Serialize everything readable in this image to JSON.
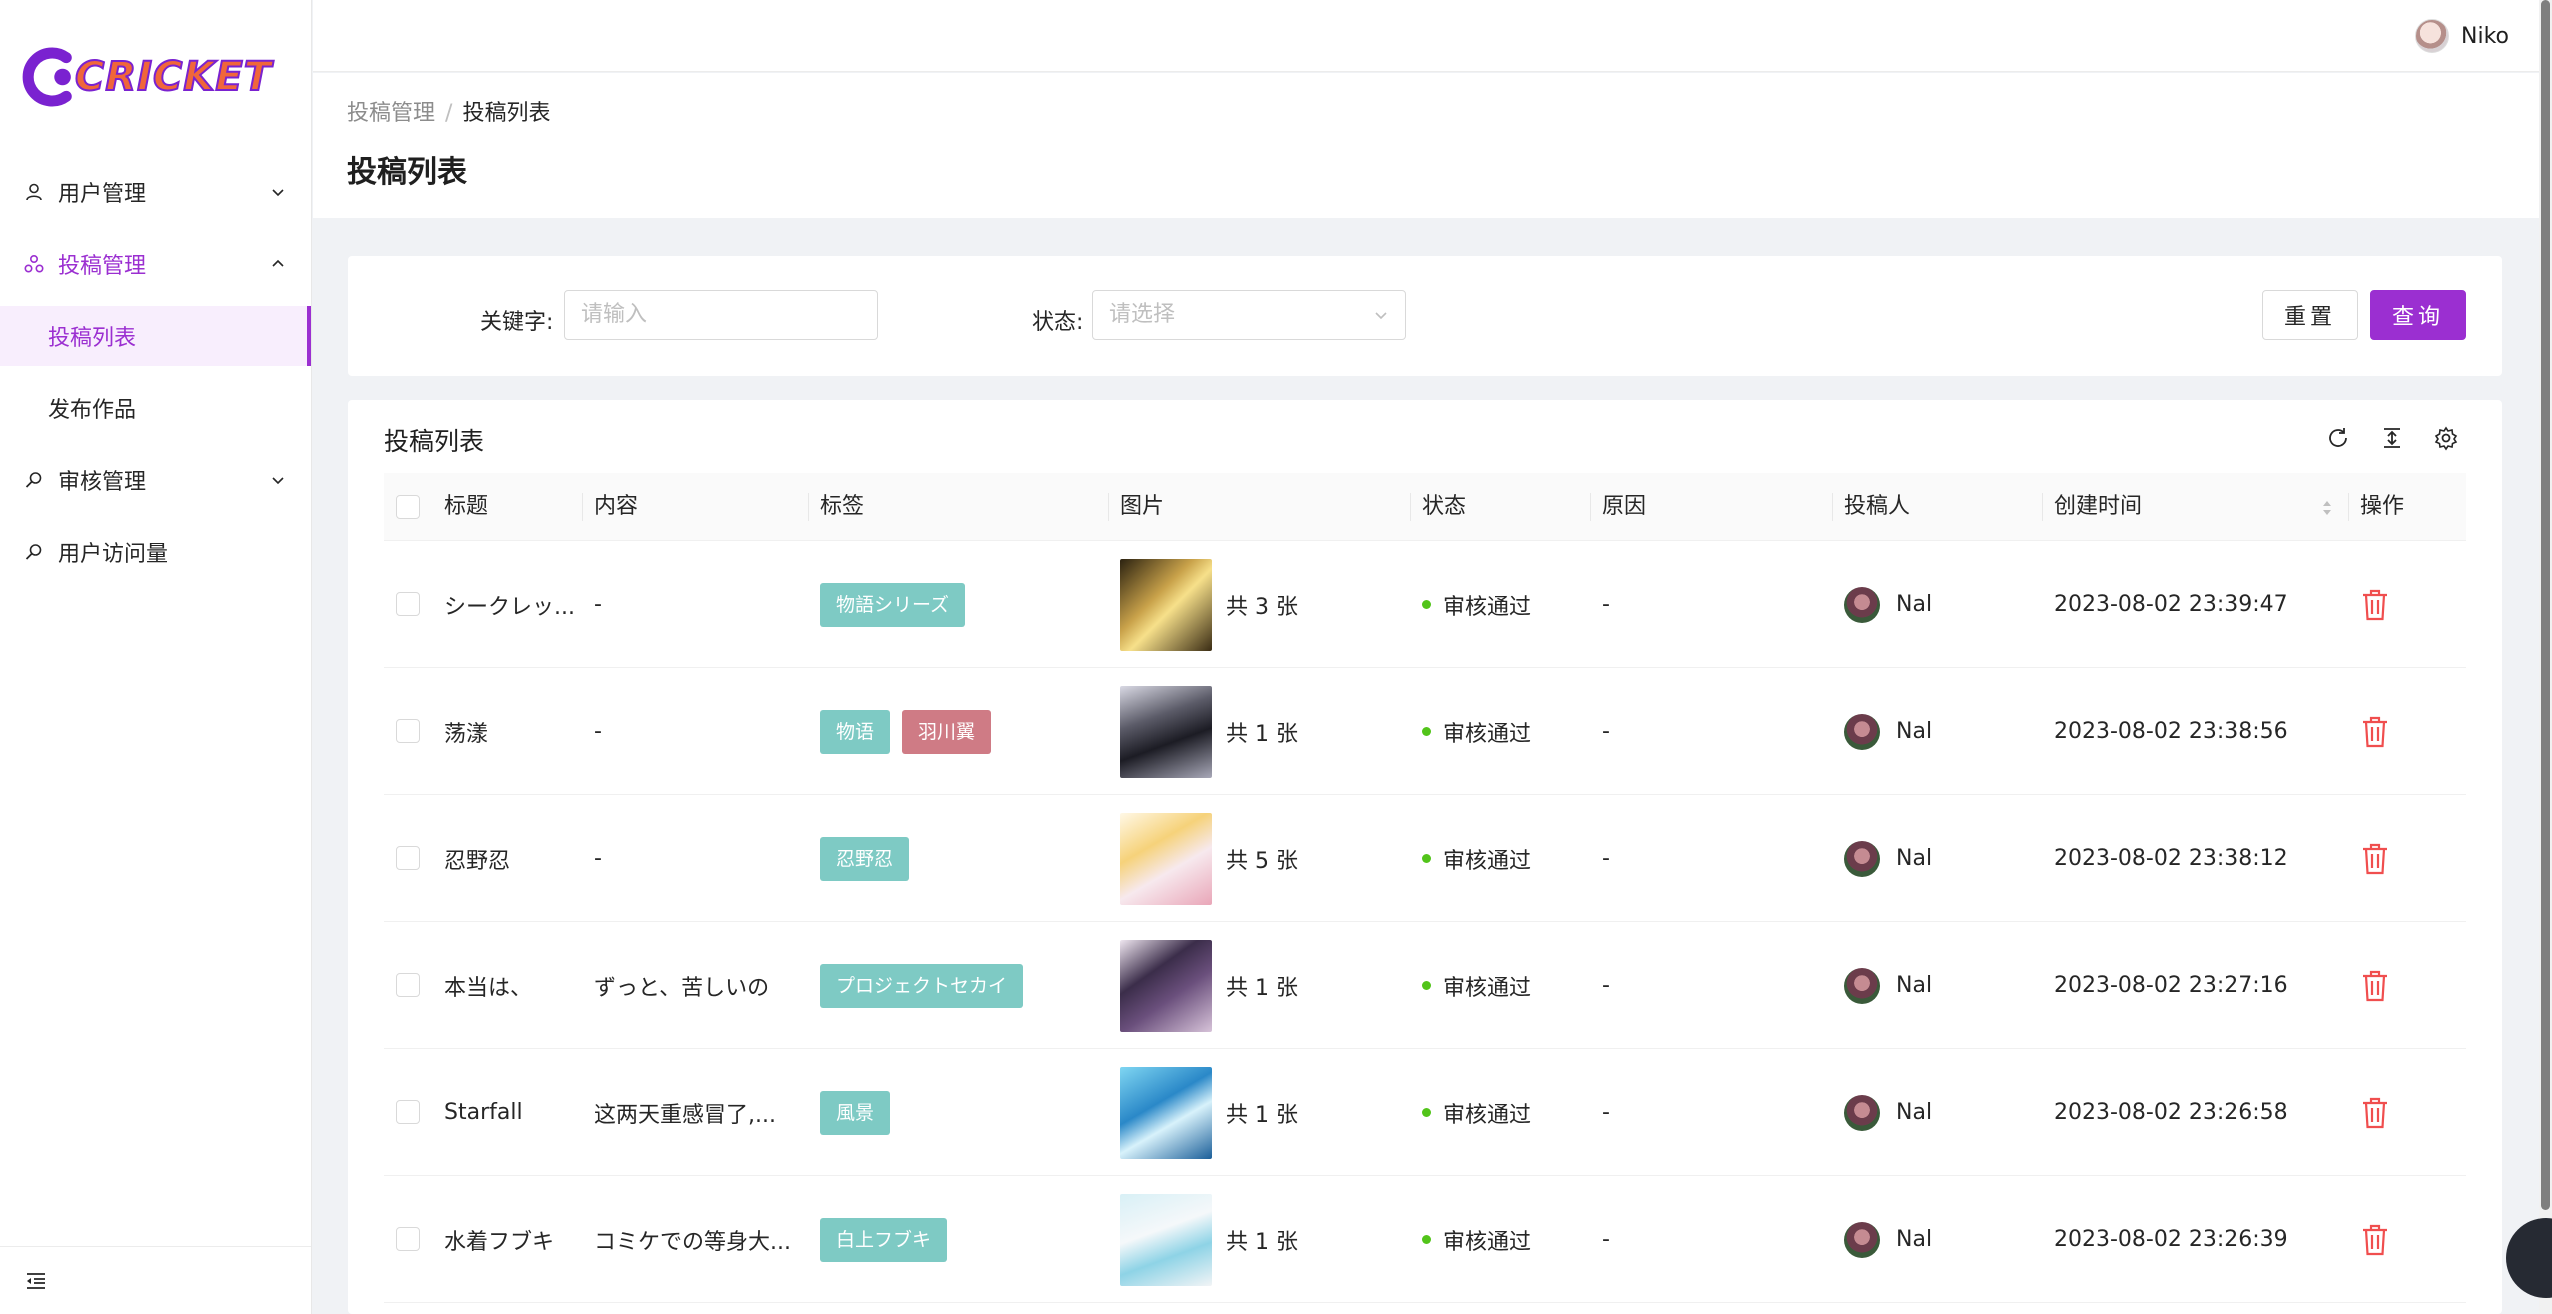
{
  "app": {
    "logo_text": "CRICKET"
  },
  "sidebar": {
    "items": [
      {
        "label": "用户管理",
        "icon": "user-icon",
        "state": "collapsed"
      },
      {
        "label": "投稿管理",
        "icon": "submission-icon",
        "state": "expanded"
      },
      {
        "label": "投稿列表",
        "sub": true,
        "active": true
      },
      {
        "label": "发布作品",
        "sub": true
      },
      {
        "label": "审核管理",
        "icon": "review-icon",
        "state": "collapsed"
      },
      {
        "label": "用户访问量",
        "icon": "visits-icon"
      }
    ]
  },
  "topbar": {
    "username": "Niko"
  },
  "breadcrumb": {
    "parent": "投稿管理",
    "separator": "/",
    "current": "投稿列表"
  },
  "page_title": "投稿列表",
  "search": {
    "keyword_label": "关键字:",
    "keyword_placeholder": "请输入",
    "status_label": "状态:",
    "status_placeholder": "请选择",
    "reset_label": "重置",
    "query_label": "查询"
  },
  "table": {
    "title": "投稿列表",
    "columns": [
      "标题",
      "内容",
      "标签",
      "图片",
      "状态",
      "原因",
      "投稿人",
      "创建时间",
      "操作"
    ],
    "rows": [
      {
        "title": "シークレッ...",
        "content": "-",
        "tags": [
          {
            "text": "物語シリーズ",
            "color": "#7ecac4"
          }
        ],
        "images": "共 3 张",
        "thumb": "linear-gradient(135deg,#2b2210 0%,#c9a24a 40%,#f7e08a 55%,#3a2c14 100%)",
        "status": "审核通过",
        "reason": "-",
        "user": "Nal",
        "time": "2023-08-02 23:39:47"
      },
      {
        "title": "荡漾",
        "content": "-",
        "tags": [
          {
            "text": "物语",
            "color": "#7ecac4"
          },
          {
            "text": "羽川翼",
            "color": "#cf7b85"
          }
        ],
        "images": "共 1 张",
        "thumb": "linear-gradient(160deg,#d9d9e4 0%,#5b5b68 35%,#1c1c24 60%,#a8a8b8 100%)",
        "status": "审核通过",
        "reason": "-",
        "user": "Nal",
        "time": "2023-08-02 23:38:56"
      },
      {
        "title": "忍野忍",
        "content": "-",
        "tags": [
          {
            "text": "忍野忍",
            "color": "#7ecac4"
          }
        ],
        "images": "共 5 张",
        "thumb": "linear-gradient(150deg,#fff8e6 0%,#f6d27a 35%,#f7e9ee 60%,#e9a6b8 100%)",
        "status": "审核通过",
        "reason": "-",
        "user": "Nal",
        "time": "2023-08-02 23:38:12"
      },
      {
        "title": "本当は、",
        "content": "ずっと、苦しいの",
        "tags": [
          {
            "text": "プロジェクトセカイ",
            "color": "#7ecac4"
          }
        ],
        "images": "共 1 张",
        "thumb": "linear-gradient(145deg,#efe6f0 0%,#3b2d4a 35%,#6a4f7c 60%,#d7c3d9 100%)",
        "status": "审核通过",
        "reason": "-",
        "user": "Nal",
        "time": "2023-08-02 23:27:16"
      },
      {
        "title": "Starfall",
        "content": "这两天重感冒了,...",
        "tags": [
          {
            "text": "風景",
            "color": "#7ecac4"
          }
        ],
        "images": "共 1 张",
        "thumb": "linear-gradient(150deg,#7fd6f2 0%,#2a88c8 40%,#d8f2fb 60%,#1b5f99 100%)",
        "status": "审核通过",
        "reason": "-",
        "user": "Nal",
        "time": "2023-08-02 23:26:58"
      },
      {
        "title": "水着フブキ",
        "content": "コミケでの等身大...",
        "tags": [
          {
            "text": "白上フブキ",
            "color": "#7ecac4"
          }
        ],
        "images": "共 1 张",
        "thumb": "linear-gradient(160deg,#d8f0f6 0%,#f5f8fa 40%,#8ed3e6 65%,#f2f4f6 100%)",
        "status": "审核通过",
        "reason": "-",
        "user": "Nal",
        "time": "2023-08-02 23:26:39"
      }
    ]
  },
  "colors": {
    "accent": "#9b2fd1",
    "tag_teal": "#7ecac4",
    "tag_rose": "#cf7b85",
    "danger": "#f04e4e",
    "success": "#52c41a"
  }
}
